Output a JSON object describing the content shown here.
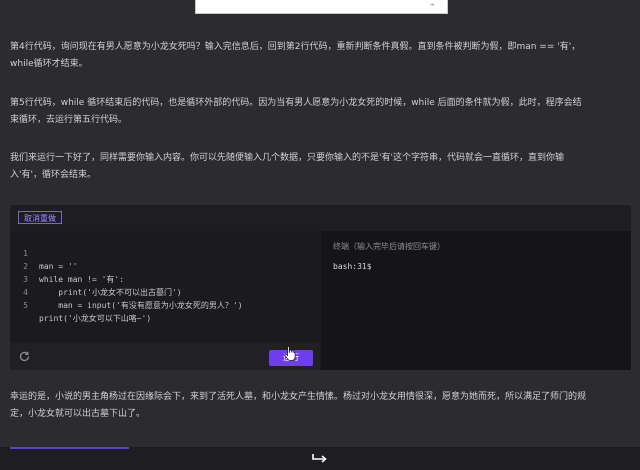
{
  "paragraphs": {
    "p1": "第4行代码，询问现在有男人愿意为小龙女死吗？输入完信息后，回到第2行代码，重新判断条件真假。直到条件被判断为假，即man == '有'，while循环才结束。",
    "p2": "第5行代码，while 循环结束后的代码，也是循环外部的代码。因为当有男人愿意为小龙女死的时候，while 后面的条件就为假，此时，程序会结束循环，去运行第五行代码。",
    "p3": "我们来运行一下好了，同样需要你输入内容。你可以先随便输入几个数据，只要你输入的不是'有'这个字符串，代码就会一直循环，直到你输入'有'，循环会结束。",
    "p4": "幸运的是，小说的男主角杨过在因缘际会下，来到了活死人墓，和小龙女产生情愫。杨过对小龙女用情很深，愿意为她而死，所以满足了师门的规定，小龙女就可以出古墓下山了。"
  },
  "editor": {
    "undo_label": "取消重做",
    "lines": [
      {
        "num": "1",
        "text": "man = ''"
      },
      {
        "num": "2",
        "text": "while man != '有':"
      },
      {
        "num": "3",
        "text": "    print('小龙女不可以出古墓门')"
      },
      {
        "num": "4",
        "text": "    man = input('有没有愿意为小龙女死的男人？')"
      },
      {
        "num": "5",
        "text": "print('小龙女可以下山咯~')"
      }
    ],
    "run_label": "运行"
  },
  "terminal": {
    "title": "终端（输入完毕后请按回车键）",
    "prompt": "bash:31$"
  },
  "colors": {
    "accent": "#6e3df0",
    "background": "#2b2b30",
    "editor_bg": "#1b1b1f",
    "terminal_bg": "#151518"
  },
  "icons": {
    "reset": "refresh-icon",
    "enter": "enter-arrow-icon",
    "cursor": "hand-cursor-icon"
  }
}
